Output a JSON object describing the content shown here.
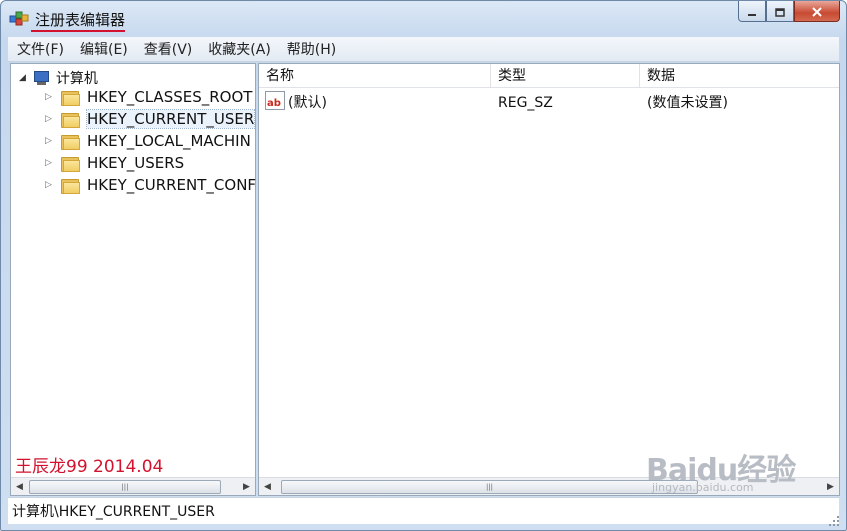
{
  "window": {
    "title": "注册表编辑器",
    "controls": {
      "minimize": "minimize-icon",
      "maximize": "maximize-icon",
      "close": "close-icon"
    }
  },
  "menubar": {
    "items": [
      "文件(F)",
      "编辑(E)",
      "查看(V)",
      "收藏夹(A)",
      "帮助(H)"
    ]
  },
  "tree": {
    "root_label": "计算机",
    "items": [
      {
        "label": "HKEY_CLASSES_ROOT",
        "selected": false
      },
      {
        "label": "HKEY_CURRENT_USER",
        "selected": true
      },
      {
        "label": "HKEY_LOCAL_MACHIN",
        "selected": false
      },
      {
        "label": "HKEY_USERS",
        "selected": false
      },
      {
        "label": "HKEY_CURRENT_CONF",
        "selected": false
      }
    ]
  },
  "values_table": {
    "columns": [
      "名称",
      "类型",
      "数据"
    ],
    "rows": [
      {
        "name": "(默认)",
        "type": "REG_SZ",
        "data": "(数值未设置)"
      }
    ]
  },
  "overlay_text": "王辰龙99 2014.04",
  "statusbar": {
    "path": "计算机\\HKEY_CURRENT_USER"
  },
  "watermark": {
    "logo": "Baidu经验",
    "sub": "jingyan.baidu.com"
  },
  "colors": {
    "annotation_red": "#d2122e",
    "selection": "#eaf2fb"
  }
}
